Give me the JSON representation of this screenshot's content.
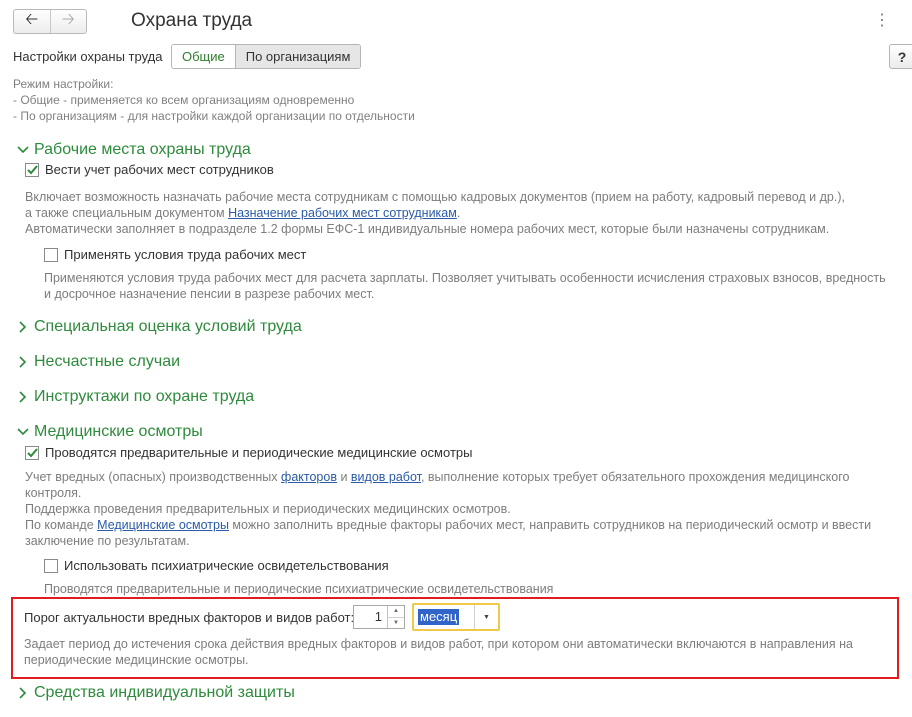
{
  "window": {
    "title": "Охрана труда",
    "back_icon": "arrow-left-icon",
    "forward_icon": "arrow-right-icon",
    "more_icon": "vertical-ellipsis-icon",
    "help_label": "?"
  },
  "mode": {
    "label": "Настройки охраны труда",
    "options": [
      "Общие",
      "По организациям"
    ],
    "selected": "Общие",
    "note_title": "Режим настройки:",
    "note_line1": "- Общие - применяется ко всем организациям одновременно",
    "note_line2": "- По организациям - для настройки каждой организации по отдельности"
  },
  "workplaces": {
    "title": "Рабочие места охраны труда",
    "expanded": true,
    "checkbox_label": "Вести учет рабочих мест сотрудников",
    "checked": true,
    "desc_line1": "Включает возможность назначать рабочие места сотрудникам с помощью кадровых документов (прием на работу, кадровый перевод и др.),",
    "desc_line2_prefix": "а также специальным документом ",
    "desc_line2_link": "Назначение рабочих мест сотрудникам",
    "desc_line2_suffix": ".",
    "desc_line3": "Автоматически заполняет в подразделе 1.2 формы ЕФС-1 индивидуальные номера рабочих мест, которые были назначены сотрудникам.",
    "conditions_label": "Применять условия труда рабочих мест",
    "conditions_checked": false,
    "conditions_desc1": "Применяются условия труда рабочих мест для расчета зарплаты. Позволяет учитывать особенности исчисления страховых взносов, вредность",
    "conditions_desc2": "и досрочное назначение пенсии в разрезе рабочих мест."
  },
  "collapsed_sections": [
    "Специальная оценка условий труда",
    "Несчастные случаи",
    "Инструктажи по охране труда"
  ],
  "medical": {
    "title": "Медицинские осмотры",
    "expanded": true,
    "checkbox_label": "Проводятся предварительные и периодические медицинские осмотры",
    "checked": true,
    "desc1_prefix": "Учет вредных (опасных) производственных ",
    "desc1_link1": "факторов",
    "desc1_mid": " и ",
    "desc1_link2": "видов работ",
    "desc1_suffix": ", выполнение которых требует обязательного прохождения медицинского",
    "desc2": "контроля.",
    "desc3": "Поддержка проведения предварительных и периодических медицинских осмотров.",
    "desc4_prefix": "По команде ",
    "desc4_link": "Медицинские осмотры",
    "desc4_suffix": " можно заполнить вредные факторы рабочих мест, направить сотрудников на периодический осмотр и ввести",
    "desc5": "заключение по результатам.",
    "psych_label": "Использовать психиатрические освидетельствования",
    "psych_checked": false,
    "psych_desc": "Проводятся предварительные и периодические психиатрические освидетельствования",
    "threshold_label": "Порог актуальности вредных факторов и видов работ:",
    "threshold_value": "1",
    "threshold_unit": "месяц",
    "threshold_desc1": "Задает период до истечения срока действия вредных факторов и видов работ, при котором они автоматически включаются в направления на",
    "threshold_desc2": "периодические медицинские осмотры."
  },
  "ppe": {
    "title": "Средства индивидуальной защиты",
    "expanded": false
  },
  "colors": {
    "accent_green": "#2e8b3c",
    "link_blue": "#2b5ba8",
    "highlight_red": "#e01c1c",
    "focus_yellow": "#f0c84a",
    "selection_blue": "#3064c8"
  }
}
